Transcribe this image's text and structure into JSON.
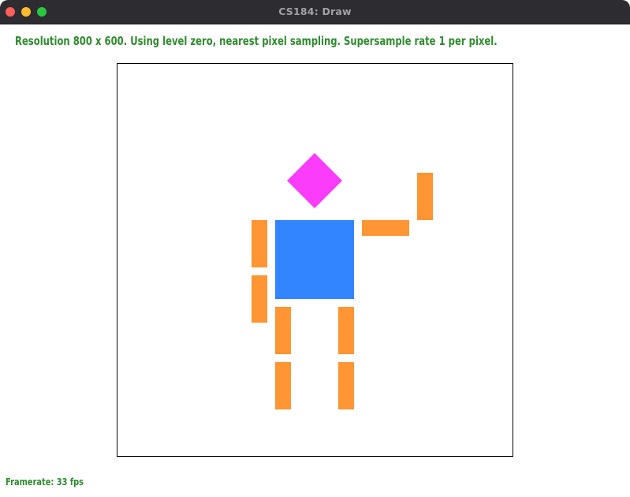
{
  "window": {
    "title": "CS184: Draw",
    "buttons": {
      "close_color": "#fe5f57",
      "minimize_color": "#febc2e",
      "maximize_color": "#28c840"
    }
  },
  "status": {
    "text": "Resolution 800 x 600. Using level zero, nearest pixel sampling. Supersample rate 1 per pixel."
  },
  "footer": {
    "framerate": "Framerate: 33 fps"
  },
  "colors": {
    "text_green": "#2e8b2e",
    "head": "#fb3cfb",
    "torso": "#3385ff",
    "limbs": "#ff9533"
  },
  "drawing": {
    "figure": "stick person",
    "head_shape": "diamond",
    "torso_shape": "square",
    "limb_shape": "rectangle"
  }
}
